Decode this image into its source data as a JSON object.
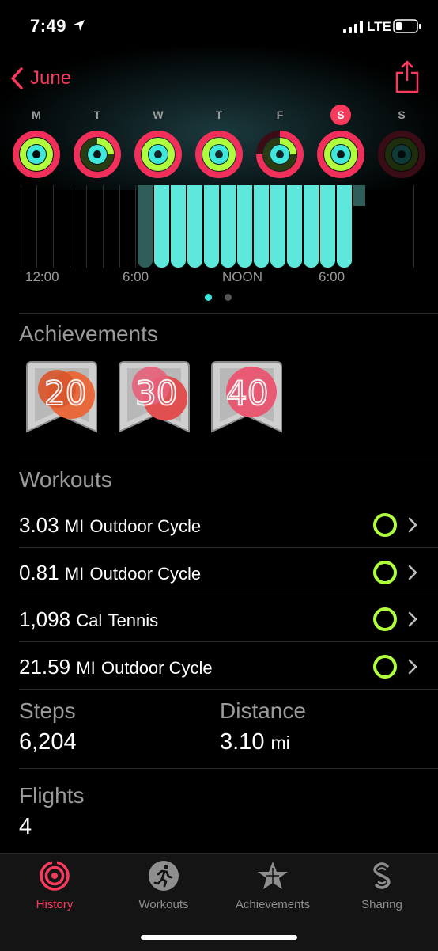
{
  "status_bar": {
    "time": "7:49",
    "carrier": "LTE"
  },
  "header": {
    "back_label": "June"
  },
  "week": {
    "days": [
      {
        "label": "M",
        "selected": false
      },
      {
        "label": "T",
        "selected": false
      },
      {
        "label": "W",
        "selected": false
      },
      {
        "label": "T",
        "selected": false
      },
      {
        "label": "F",
        "selected": false
      },
      {
        "label": "S",
        "selected": true
      },
      {
        "label": "S",
        "selected": false
      }
    ]
  },
  "chart": {
    "ticks": [
      "12:00",
      "6:00",
      "NOON",
      "6:00"
    ],
    "page_dots": 2,
    "active_page": 0
  },
  "achievements": {
    "title": "Achievements",
    "badges": [
      "20",
      "30",
      "40"
    ]
  },
  "workouts": {
    "title": "Workouts",
    "items": [
      {
        "value": "3.03",
        "unit": "MI",
        "name": "Outdoor Cycle"
      },
      {
        "value": "0.81",
        "unit": "MI",
        "name": "Outdoor Cycle"
      },
      {
        "value": "1,098",
        "unit": "Cal",
        "name": "Tennis"
      },
      {
        "value": "21.59",
        "unit": "MI",
        "name": "Outdoor Cycle"
      }
    ]
  },
  "stats": {
    "steps_label": "Steps",
    "steps_value": "6,204",
    "distance_label": "Distance",
    "distance_value": "3.10",
    "distance_unit": "mi",
    "flights_label": "Flights",
    "flights_value": "4"
  },
  "tabbar": {
    "tabs": [
      {
        "label": "History",
        "icon": "history-icon",
        "active": true
      },
      {
        "label": "Workouts",
        "icon": "runner-icon",
        "active": false
      },
      {
        "label": "Achievements",
        "icon": "star-icon",
        "active": false
      },
      {
        "label": "Sharing",
        "icon": "sharing-icon",
        "active": false
      }
    ]
  },
  "colors": {
    "accent": "#fa3a5c",
    "move": "#f0305a",
    "exercise": "#b0ff3c",
    "stand": "#3ee8dc",
    "chart_bar": "#5ee8dc"
  }
}
